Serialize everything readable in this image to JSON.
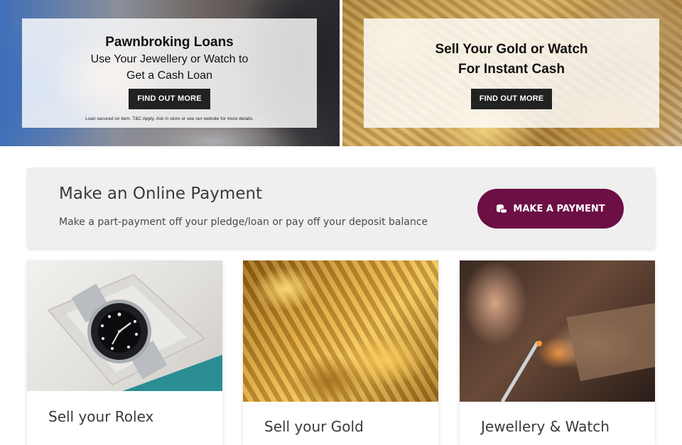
{
  "banners": {
    "pawn": {
      "heading": "Pawnbroking Loans",
      "sub_line1": "Use Your Jewellery or Watch to",
      "sub_line2": "Get a Cash Loan",
      "button": "FIND OUT MORE",
      "fine_print": "Loan secured on item. T&C Apply. Ask in store or see our website for more details."
    },
    "sell": {
      "heading_line1": "Sell Your Gold or Watch",
      "heading_line2": "For Instant Cash",
      "button": "FIND OUT MORE"
    }
  },
  "payment": {
    "title": "Make an Online Payment",
    "description": "Make a part-payment off your pledge/loan or pay off your deposit balance",
    "button_label": "MAKE A PAYMENT",
    "button_icon": "coins-icon",
    "button_color": "#6b0f45"
  },
  "cards": [
    {
      "title": "Sell your Rolex",
      "image": "rolex-watch-in-box"
    },
    {
      "title": "Sell your Gold",
      "image": "gold-chains"
    },
    {
      "title": "Jewellery & Watch",
      "image": "jeweller-at-work"
    }
  ]
}
